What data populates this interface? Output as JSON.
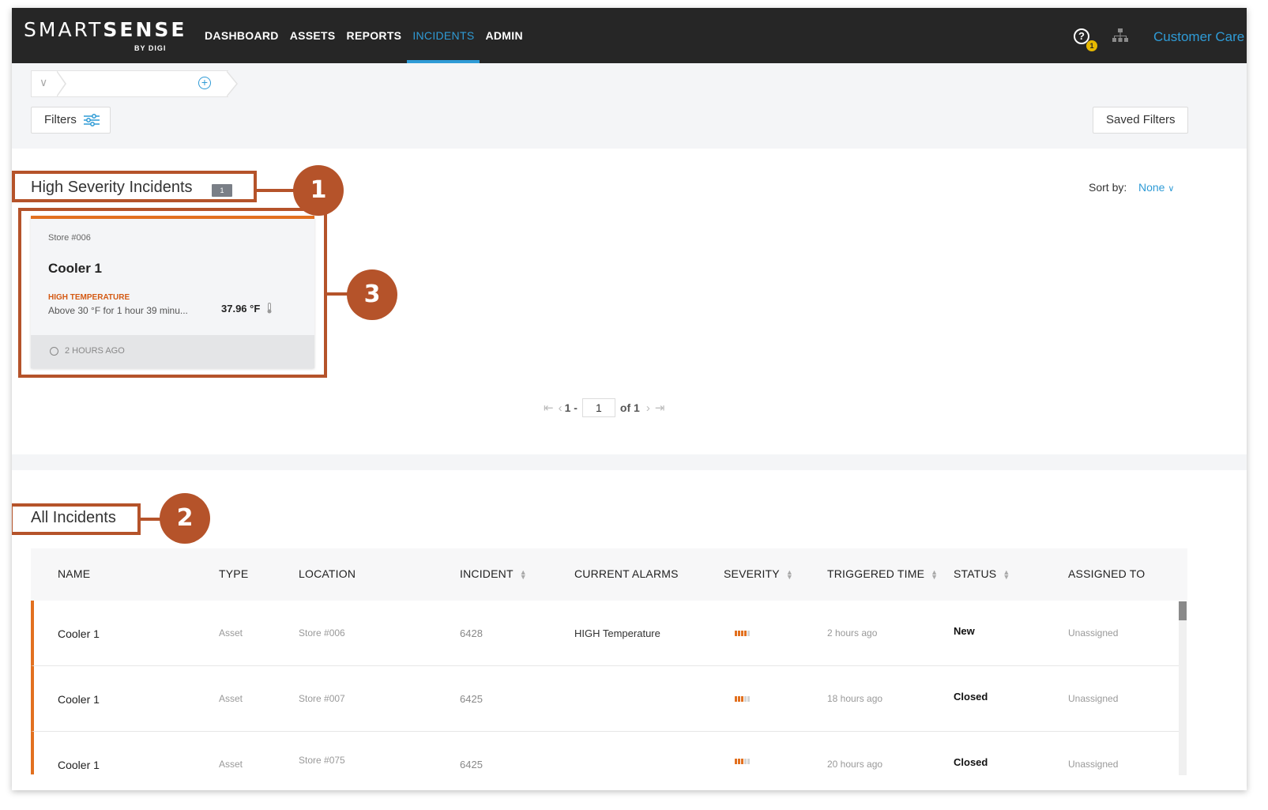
{
  "app": {
    "logo_smart": "SMART",
    "logo_sense": "SENSE",
    "logo_by": "BY DIGI"
  },
  "nav": {
    "items": [
      {
        "label": "DASHBOARD",
        "active": false
      },
      {
        "label": "ASSETS",
        "active": false
      },
      {
        "label": "REPORTS",
        "active": false
      },
      {
        "label": "INCIDENTS",
        "active": true
      },
      {
        "label": "ADMIN",
        "active": false
      }
    ],
    "help_icon": "help-circle-icon",
    "help_glyph": "?",
    "help_badge": "1",
    "org_icon": "org-chart-icon",
    "customer_care": "Customer Care"
  },
  "filterbar": {
    "filters_label": "Filters",
    "saved_filters_label": "Saved Filters"
  },
  "high_severity": {
    "title": "High Severity Incidents",
    "count": "1",
    "sort_label": "Sort by:",
    "sort_value": "None",
    "cards": [
      {
        "store": "Store #006",
        "name": "Cooler 1",
        "alarm": "HIGH TEMPERATURE",
        "description": "Above 30 °F for 1 hour 39 minu...",
        "temperature": "37.96 °F",
        "time": "2 HOURS AGO"
      }
    ],
    "pager": {
      "range": "1 -",
      "page": "1",
      "total": "of 1"
    }
  },
  "all_incidents": {
    "title": "All Incidents",
    "columns": [
      "NAME",
      "TYPE",
      "LOCATION",
      "INCIDENT",
      "CURRENT ALARMS",
      "SEVERITY",
      "TRIGGERED TIME",
      "STATUS",
      "ASSIGNED TO"
    ],
    "sortable": [
      false,
      false,
      false,
      true,
      false,
      true,
      true,
      true,
      false
    ],
    "rows": [
      {
        "name": "Cooler 1",
        "type": "Asset",
        "location": "Store #006",
        "incident": "6428",
        "alarms": "HIGH Temperature",
        "severity_bars": 4,
        "triggered": "2 hours ago",
        "status": "New",
        "assigned": "Unassigned"
      },
      {
        "name": "Cooler 1",
        "type": "Asset",
        "location": "Store #007",
        "incident": "6425",
        "alarms": "",
        "severity_bars": 3,
        "triggered": "18 hours ago",
        "status": "Closed",
        "assigned": "Unassigned"
      },
      {
        "name": "Cooler 1",
        "type": "Asset",
        "location": "Store #075",
        "incident": "6425",
        "alarms": "",
        "severity_bars": 3,
        "triggered": "20 hours ago",
        "status": "Closed",
        "assigned": "Unassigned"
      }
    ]
  },
  "callouts": [
    "1",
    "2",
    "3"
  ],
  "colors": {
    "accent": "#2f9bd6",
    "nav_bg": "#262626",
    "severity": "#e2701f",
    "callout": "#b5532a"
  }
}
